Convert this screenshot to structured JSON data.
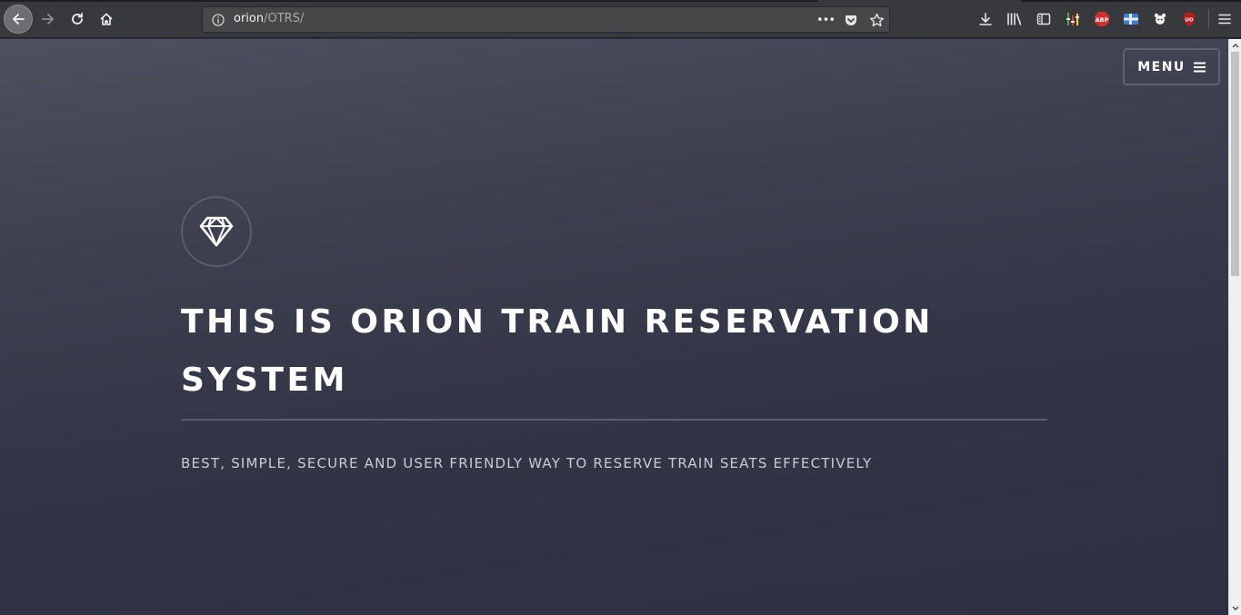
{
  "browser": {
    "url_host": "orion",
    "url_path": "/OTRS/",
    "page_actions_label": "•••"
  },
  "nav": {
    "menu_label": "MENU"
  },
  "hero": {
    "title": "THIS IS ORION TRAIN RESERVATION SYSTEM",
    "subtitle": "BEST, SIMPLE, SECURE AND USER FRIENDLY WAY TO RESERVE TRAIN SEATS EFFECTIVELY"
  },
  "toolbar": {
    "abp_badge": "ABP",
    "ublock_badge": "UO"
  },
  "icons": {
    "logo": "diamond-icon",
    "back": "arrow-left-icon",
    "forward": "arrow-right-icon",
    "reload": "reload-icon",
    "home": "home-icon",
    "menu": "hamburger-icon"
  },
  "colors": {
    "page_top": "#4d505d",
    "page_bottom": "#2d3042",
    "accent_border": "#5a5d6c",
    "text_primary": "#ffffff",
    "text_secondary": "#c9cbd3"
  }
}
